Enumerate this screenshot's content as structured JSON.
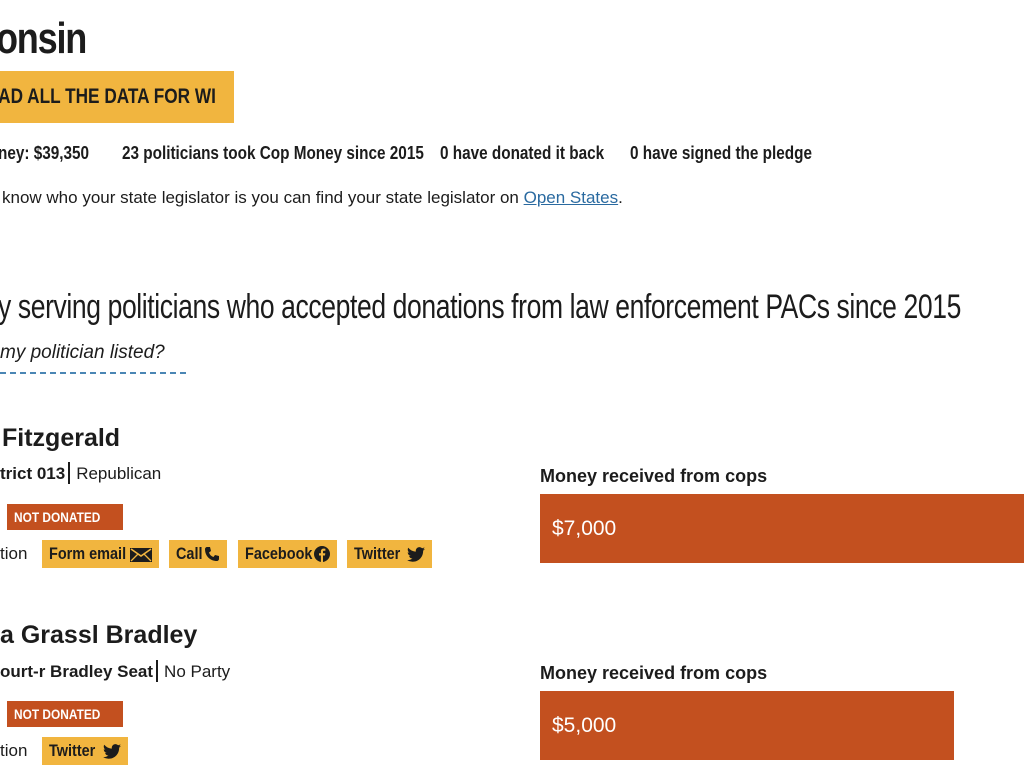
{
  "header": {
    "title": "onsin",
    "download_label": "OAD ALL THE DATA FOR WI"
  },
  "stats": {
    "money": "ney: $39,350",
    "politicians": "23 politicians took Cop Money since 2015",
    "donated_back": "0 have donated it back",
    "pledge": "0 have signed the pledge"
  },
  "legislator_note": {
    "text": "know who your state legislator is you can find your state legislator on ",
    "link": "Open States",
    "suffix": "."
  },
  "section": {
    "heading": "y serving politicians who accepted donations from law enforcement PACs since 2015",
    "question": "my politician listed?"
  },
  "politicians": [
    {
      "name": "Fitzgerald",
      "district": "trict 013",
      "party": "Republican",
      "badge": "NOT DONATED",
      "action_label": "tion",
      "actions": [
        "Form email",
        "Call",
        "Facebook",
        "Twitter"
      ],
      "money_label": "Money received from cops",
      "amount": "$7,000",
      "amount_value": 7000
    },
    {
      "name": "a Grassl Bradley",
      "district": "ourt-r Bradley Seat",
      "party": "No Party",
      "badge": "NOT DONATED",
      "action_label": "tion",
      "actions": [
        "Twitter"
      ],
      "money_label": "Money received from cops",
      "amount": "$5,000",
      "amount_value": 5000
    }
  ],
  "colors": {
    "accent_yellow": "#f1b53f",
    "accent_orange": "#c3501f",
    "link_blue": "#2a6aa0"
  },
  "icons": {
    "form_email": "envelope-icon",
    "call": "phone-icon",
    "facebook": "facebook-icon",
    "twitter": "twitter-icon"
  }
}
